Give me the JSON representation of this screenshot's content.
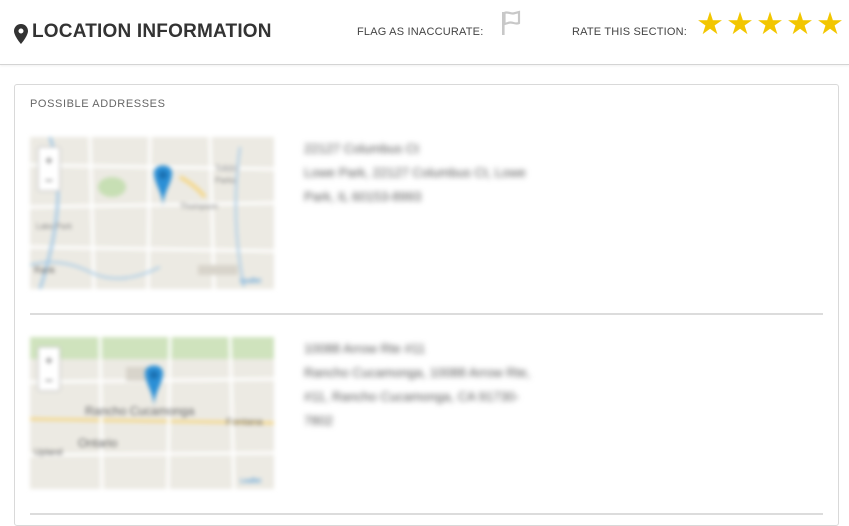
{
  "header": {
    "title": "LOCATION INFORMATION",
    "icon": "map-pin-icon",
    "flag_label": "FLAG AS INACCURATE:",
    "flag_icon": "flag-icon",
    "rate_label": "RATE THIS SECTION:",
    "stars": [
      "★",
      "★",
      "★",
      "★",
      "★"
    ],
    "star_color": "#f2c600"
  },
  "panel": {
    "section_label": "POSSIBLE ADDRESSES",
    "addresses": [
      {
        "lines": [
          "22127 Columbus Ct",
          "Lowe Park, 22127 Columbus Ct, Lowe",
          "Park, IL 60153-8993"
        ],
        "map_labels": [
          "Tolldin",
          "Parks",
          "Lake Park",
          "Lake Terr",
          "Roselle",
          "Thompson",
          "Rank",
          "Leaflet"
        ]
      },
      {
        "lines": [
          "10088 Arrow Rte #11",
          "Rancho Cucamonga, 10088 Arrow Rte,",
          "#11, Rancho Cucamonga, CA 91730-",
          "7802"
        ],
        "map_labels": [
          "Rancho Cucamonga",
          "Fontana",
          "Ontario",
          "Upland",
          "Leaflet"
        ]
      }
    ]
  },
  "colors": {
    "accent": "#2a8fd6",
    "map_bg": "#eceae3",
    "divider": "#dcdcdc"
  }
}
